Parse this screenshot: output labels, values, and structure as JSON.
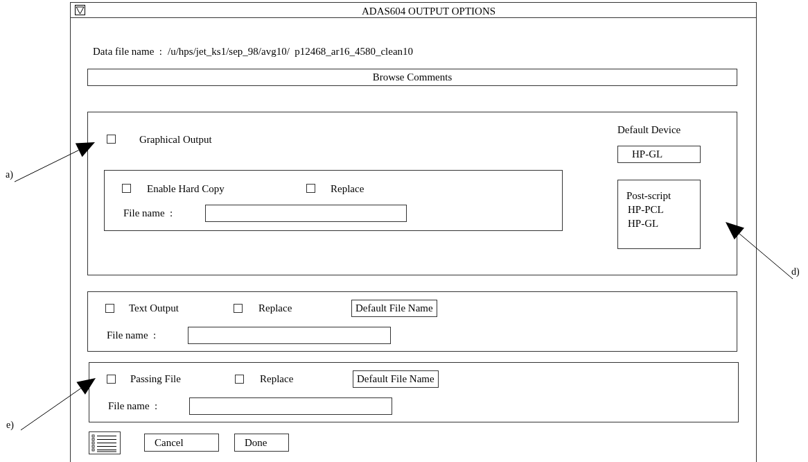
{
  "window": {
    "title": "ADAS604 OUTPUT OPTIONS"
  },
  "data_file": {
    "label": "Data file name  :",
    "value": "/u/hps/jet_ks1/sep_98/avg10/  p12468_ar16_4580_clean10"
  },
  "browse_button": "Browse Comments",
  "graphical_output": {
    "label": "Graphical Output",
    "checked": false,
    "hard_copy": {
      "label": "Enable Hard Copy",
      "checked": false
    },
    "replace": {
      "label": "Replace",
      "checked": false
    },
    "file_label": "File name  :",
    "default_device": {
      "label": "Default Device",
      "value": "HP-GL",
      "options": [
        "Post-script",
        "HP-PCL",
        "HP-GL"
      ]
    }
  },
  "text_output": {
    "label": "Text Output",
    "checked": false,
    "replace": {
      "label": "Replace",
      "checked": false
    },
    "default_button": "Default File Name",
    "file_label": "File name  :"
  },
  "passing_file": {
    "label": "Passing File",
    "checked": false,
    "replace": {
      "label": "Replace",
      "checked": false
    },
    "default_button": "Default File Name",
    "file_label": "File name  :"
  },
  "buttons": [
    "Cancel",
    "Done"
  ],
  "annotations": [
    {
      "label": "a)"
    },
    {
      "label": "d)"
    },
    {
      "label": "e)"
    }
  ]
}
